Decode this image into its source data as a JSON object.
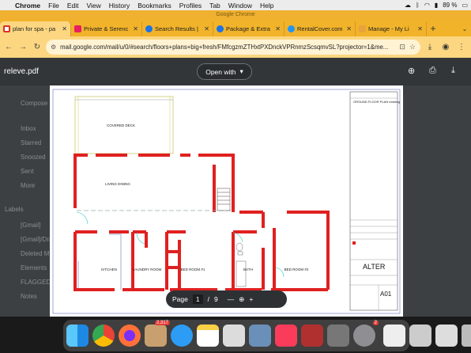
{
  "menubar": {
    "app": "Chrome",
    "items": [
      "File",
      "Edit",
      "View",
      "History",
      "Bookmarks",
      "Profiles",
      "Tab",
      "Window",
      "Help"
    ],
    "battery": "89 %"
  },
  "window_title": "Google Chrome",
  "tabs": [
    {
      "label": "plan for spa - pa",
      "color": "#d93025"
    },
    {
      "label": "Private & Serenc",
      "color": "#e91e63"
    },
    {
      "label": "Search Results |",
      "color": "#1a73e8"
    },
    {
      "label": "Package & Extra",
      "color": "#1a73e8"
    },
    {
      "label": "RentalCover.com",
      "color": "#2196f3"
    },
    {
      "label": "Manage - My Li",
      "color": "#e8a33c"
    }
  ],
  "new_tab": "+",
  "address": {
    "url": "mail.google.com/mail/u/0/#search/floors+plans+big+fresh/FMfcgzmZTHxtPXDnckVPRnmzScsqmvSL?projector=1&me..."
  },
  "viewer": {
    "filename": "releve.pdf",
    "open_with": "Open with"
  },
  "gmail_sidebar": [
    "Compose",
    "Inbox",
    "Starred",
    "Snoozed",
    "Sent",
    "More",
    "Labels",
    "[Gmail]",
    "[Gmail]/Dra",
    "Deleted M",
    "Elements",
    "FLAGGED",
    "Notes"
  ],
  "plan": {
    "rooms": {
      "covered_deck": "COVERED    DECK",
      "living_dining": "LIVING    DINING",
      "kitchen": "KITCHEN",
      "laundry": "LAUNDRY ROOM",
      "bed1": "BED ROOM #1",
      "bath": "BATH",
      "bed2": "BED ROOM #2"
    },
    "title_block": {
      "title": "GROUND FLOOR PLAN existing",
      "company": "ALTER",
      "sheet": "A01"
    }
  },
  "pagebar": {
    "label": "Page",
    "current": "1",
    "separator": "/",
    "total": "9"
  },
  "dock": {
    "photos_badge": "2,317",
    "settings_badge": "2"
  }
}
